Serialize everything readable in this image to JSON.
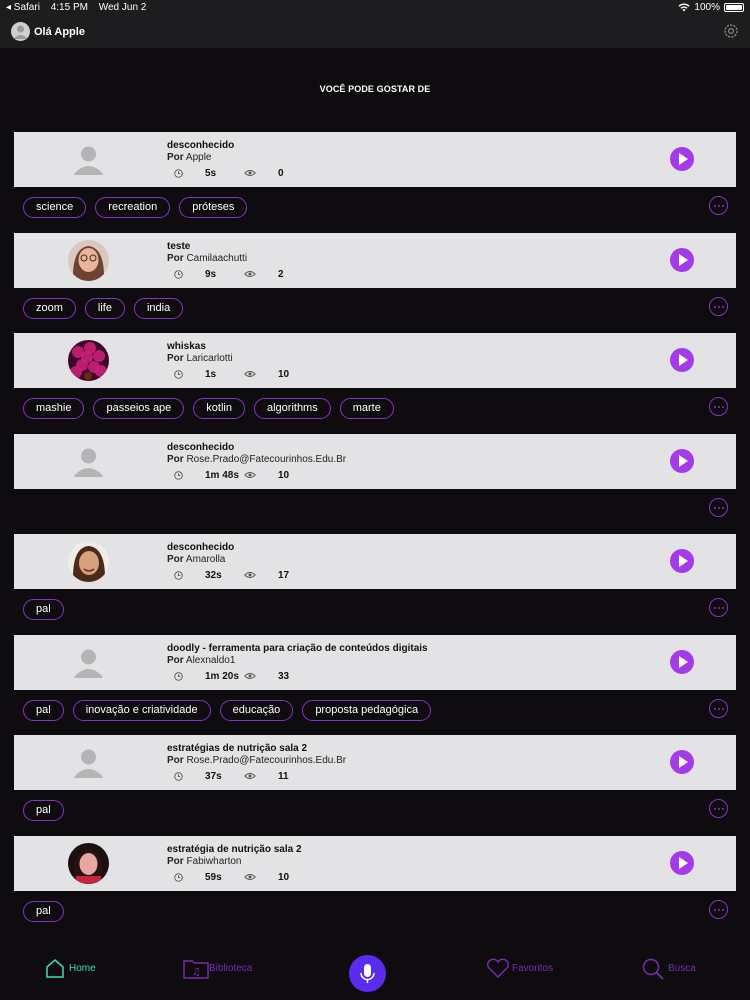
{
  "status_bar": {
    "app": "◂ Safari",
    "time": "4:15 PM",
    "date": "Wed Jun 2",
    "battery": "100%"
  },
  "header": {
    "greeting": "Olá Apple"
  },
  "section_title": "VOCÊ PODE GOSTAR DE",
  "author_prefix": "Por",
  "items": [
    {
      "title": "desconhecido",
      "author": "Apple",
      "duration": "5s",
      "views": "0",
      "avatar": "placeholder",
      "tags": [
        "science",
        "recreation",
        "próteses"
      ]
    },
    {
      "title": "teste",
      "author": "Camilaachutti",
      "duration": "9s",
      "views": "2",
      "avatar": "photo-woman-glasses",
      "tags": [
        "zoom",
        "life",
        "india"
      ]
    },
    {
      "title": "whiskas",
      "author": "Laricarlotti",
      "duration": "1s",
      "views": "10",
      "avatar": "photo-magenta-flowers",
      "tags": [
        "mashie",
        "passeios ape",
        "kotlin",
        "algorithms",
        "marte"
      ]
    },
    {
      "title": "desconhecido",
      "author": "Rose.Prado@Fatecourinhos.Edu.Br",
      "duration": "1m 48s",
      "views": "10",
      "avatar": "placeholder",
      "tags": []
    },
    {
      "title": "desconhecido",
      "author": "Amarolla",
      "duration": "32s",
      "views": "17",
      "avatar": "photo-woman-smiling",
      "tags": [
        "pal"
      ]
    },
    {
      "title": "doodly - ferramenta para criação de conteúdos digitais",
      "author": "Alexnaldo1",
      "duration": "1m 20s",
      "views": "33",
      "avatar": "placeholder",
      "tags": [
        "pal",
        "inovação e criatividade",
        "educação",
        "proposta pedagógica"
      ]
    },
    {
      "title": "estratégias de nutrição sala 2",
      "author": "Rose.Prado@Fatecourinhos.Edu.Br",
      "duration": "37s",
      "views": "11",
      "avatar": "placeholder",
      "tags": [
        "pal"
      ]
    },
    {
      "title": "estratégia de nutrição sala 2",
      "author": "Fabiwharton",
      "duration": "59s",
      "views": "10",
      "avatar": "photo-woman-red",
      "tags": [
        "pal"
      ]
    }
  ],
  "tabbar": {
    "home": "Home",
    "library": "Biblioteca",
    "favorites": "Favoritos",
    "search": "Busca"
  },
  "colors": {
    "accent": "#a33bea",
    "tag_border": "#8b30c8",
    "home_active": "#3ee0b0",
    "mic": "#5b2cf0"
  }
}
